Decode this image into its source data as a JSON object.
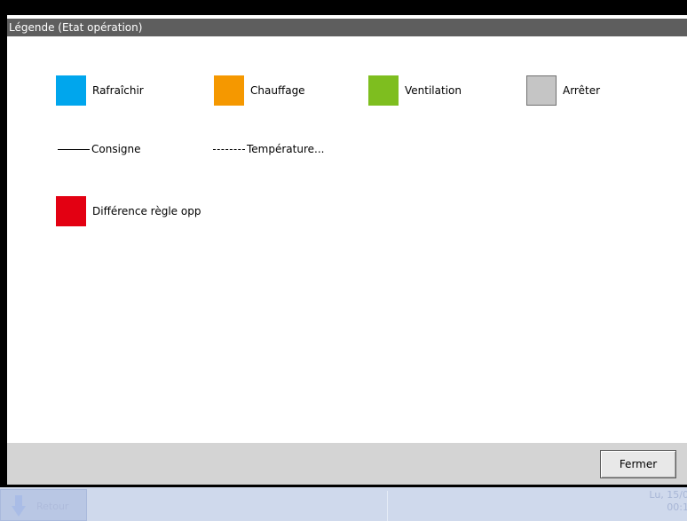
{
  "dialog": {
    "title": "Légende (Etat opération)",
    "close_label": "Fermer"
  },
  "legend": {
    "modes": [
      {
        "label": "Rafraîchir",
        "color": "#00a6ed"
      },
      {
        "label": "Chauffage",
        "color": "#f59800"
      },
      {
        "label": "Ventilation",
        "color": "#7ebe1f"
      },
      {
        "label": "Arrêter",
        "color": "#c5c5c5"
      }
    ],
    "lines": [
      {
        "label": "Consigne",
        "style": "solid"
      },
      {
        "label": "Température...",
        "style": "dashed"
      }
    ],
    "alerts": [
      {
        "label": "Différence règle opp",
        "color": "#e30012"
      }
    ]
  },
  "taskbar": {
    "start_icon": "down-arrow-icon",
    "start_label": "Retour",
    "clock_line1": "Lu, 15/0",
    "clock_line2": "00:1"
  }
}
